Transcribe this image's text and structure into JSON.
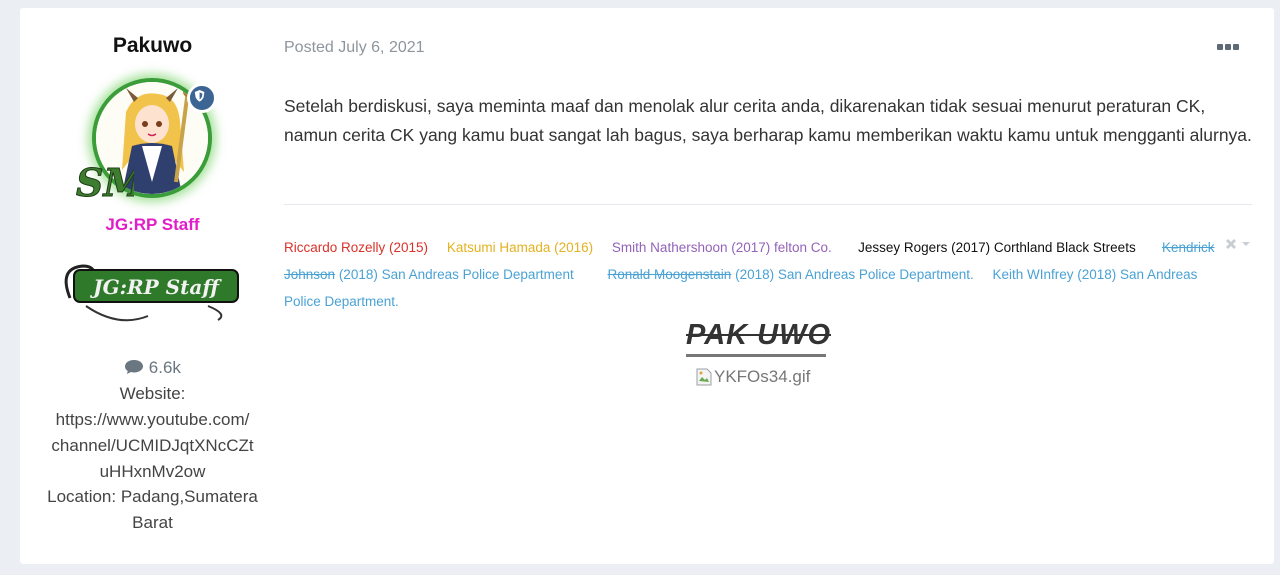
{
  "author": {
    "name": "Pakuwo",
    "avatar_alt": "anime character avatar",
    "badge_icon": "shield-icon",
    "group_title": "JG:RP Staff",
    "group_banner_text": "JG:RP Staff",
    "post_count": "6.6k",
    "website_label": "Website:",
    "website_lines": [
      "https://www.youtube.com/",
      "channel/UCMIDJqtXNcCZt",
      "uHHxnMv2ow"
    ],
    "location_lines": [
      "Location: Padang,Sumatera",
      "Barat"
    ]
  },
  "post": {
    "date": "Posted July 6, 2021",
    "more_icon": "ellipsis-icon",
    "body": "Setelah berdiskusi, saya meminta maaf dan menolak alur cerita anda, dikarenakan tidak sesuai menurut peraturan CK, namun cerita CK yang kamu buat sangat lah bagus, saya berharap kamu memberikan waktu kamu untuk mengganti alurnya."
  },
  "signature": {
    "close_icon": "close-icon",
    "chevron_icon": "chevron-down-icon",
    "entries": {
      "e1": "Riccardo Rozelly (2015)",
      "e2": "Katsumi Hamada (2016)",
      "e3": "Smith Nathershoon (2017) felton Co.",
      "e4": "Jessey Rogers (2017) Corthland Black Streets",
      "e5_strike": "Kendrick Johnson",
      "e5_rest": "(2018) San Andreas Police Department",
      "e6_strike": "Ronald Moogenstain",
      "e6_rest": "(2018) San Andreas Police Department.",
      "e7": "Keith WInfrey  (2018) San Andreas Police Department."
    },
    "title": "PAK UWO",
    "image_alt": "YKFOs34.gif"
  },
  "colors": {
    "accent_blue": "#4aa2d4",
    "staff_pink": "#e21ec8",
    "red": "#d9322a",
    "yellow": "#e3b21f",
    "purple": "#9462b9"
  }
}
